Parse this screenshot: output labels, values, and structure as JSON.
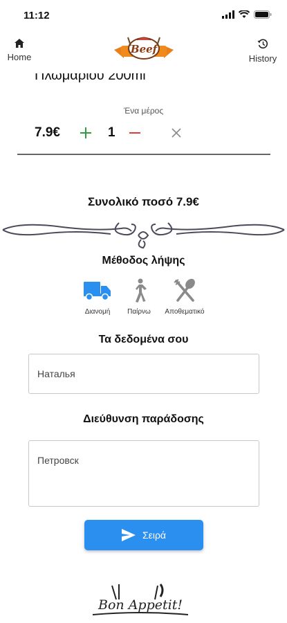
{
  "status_bar": {
    "time": "11:12"
  },
  "header": {
    "home_label": "Home",
    "history_label": "History",
    "logo_text": "Beef"
  },
  "item": {
    "title": "Πλωμαρίου 200ml",
    "portion": "Ένα μέρος",
    "price": "7.9€",
    "quantity": "1"
  },
  "total": "Συνολικό ποσό 7.9€",
  "pickup": {
    "title": "Μέθοδος λήψης",
    "options": [
      {
        "label": "Διανομή",
        "icon": "truck-icon",
        "selected": true
      },
      {
        "label": "Παίρνω",
        "icon": "walking-person-icon",
        "selected": false
      },
      {
        "label": "Αποθεματικό",
        "icon": "utensils-icon",
        "selected": false
      }
    ]
  },
  "customer": {
    "title": "Τα δεδομένα σου",
    "name_value": "Наталья",
    "address_title": "Διεύθυνση παράδοσης",
    "address_value": "Петровск"
  },
  "order_button": {
    "label": "Σειρά"
  },
  "footer": {
    "logo_text": "Bon Appetit!"
  },
  "colors": {
    "accent": "#2b8ff0",
    "plus": "#2e9d3f",
    "minus": "#e03a3a",
    "inactive_icon": "#8a8a8a"
  }
}
